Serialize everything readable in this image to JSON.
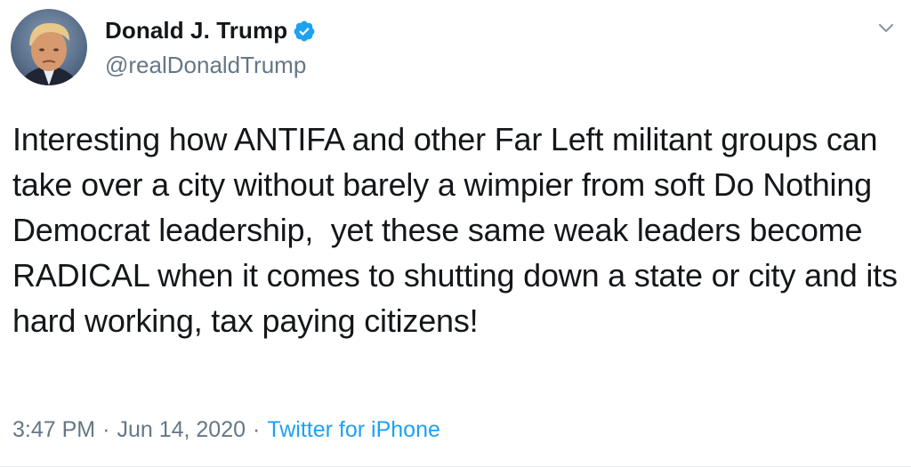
{
  "author": {
    "display_name": "Donald J. Trump",
    "handle": "@realDonaldTrump",
    "verified": true,
    "avatar_icon": "profile-photo"
  },
  "tweet": {
    "text": "Interesting how ANTIFA and other Far Left militant groups can take over a city without barely a wimpier from soft Do Nothing Democrat leadership,  yet these same weak leaders become RADICAL when it comes to shutting down a state or city and its hard working, tax paying citizens!"
  },
  "meta": {
    "time": "3:47 PM",
    "date": "Jun 14, 2020",
    "separator": "·",
    "source": "Twitter for iPhone"
  },
  "icons": {
    "verified_badge": "verified-badge-icon",
    "more_options": "chevron-down-icon"
  },
  "colors": {
    "text_primary": "#14171a",
    "text_secondary": "#657786",
    "accent": "#1da1f2"
  }
}
